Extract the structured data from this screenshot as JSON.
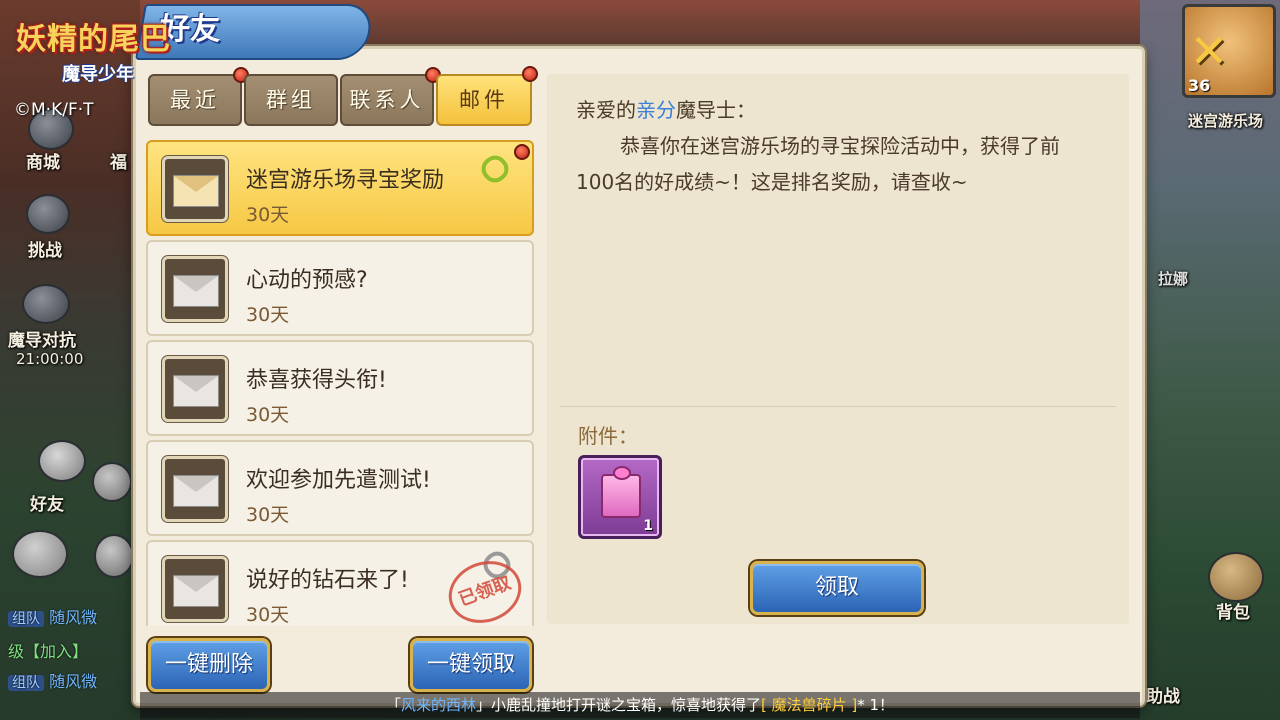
{
  "header": {
    "logo_main": "妖精的尾巴",
    "logo_sub": "魔导少年",
    "title": "好友",
    "copyright": "©M·K/F·T"
  },
  "left_side": {
    "shop": "商城",
    "welfare": "福",
    "challenge": "挑战",
    "arena": "魔导对抗",
    "arena_time": "21:00:00",
    "friends": "好友",
    "chat_lines": [
      {
        "tag": "组队",
        "text": "随风微"
      },
      {
        "tag": "",
        "text": "级【加入】"
      },
      {
        "tag": "组队",
        "text": "随风微"
      }
    ]
  },
  "right_side": {
    "level": "36",
    "event": "迷宫游乐场",
    "npc": "拉娜",
    "bag": "背包",
    "assist": "助战"
  },
  "tabs": [
    {
      "label": "最近",
      "active": false,
      "dot": true
    },
    {
      "label": "群组",
      "active": false,
      "dot": false
    },
    {
      "label": "联系人",
      "active": false,
      "dot": true
    },
    {
      "label": "邮件",
      "active": true,
      "dot": true
    }
  ],
  "mails": [
    {
      "title": "迷宫游乐场寻宝奖励",
      "days": "30天",
      "selected": true,
      "attachment": true,
      "claimed": false
    },
    {
      "title": "心动的预感?",
      "days": "30天",
      "selected": false,
      "attachment": false,
      "claimed": false
    },
    {
      "title": "恭喜获得头衔!",
      "days": "30天",
      "selected": false,
      "attachment": false,
      "claimed": false
    },
    {
      "title": "欢迎参加先遣测试!",
      "days": "30天",
      "selected": false,
      "attachment": false,
      "claimed": false
    },
    {
      "title": "说好的钻石来了!",
      "days": "30天",
      "selected": false,
      "attachment": true,
      "claimed": true
    }
  ],
  "claimed_stamp": "已领取",
  "buttons": {
    "delete_all": "一键删除",
    "claim_all": "一键领取",
    "claim": "领取"
  },
  "detail": {
    "greeting_prefix": "亲爱的",
    "greeting_name": "亲分",
    "greeting_suffix": "魔导士：",
    "body": "恭喜你在迷宫游乐场的寻宝探险活动中，获得了前100名的好成绩~！这是排名奖励，请查收~",
    "attachment_label": "附件：",
    "attachment_count": "1"
  },
  "marquee": {
    "open": "「",
    "name": "风来的西林",
    "close": "」",
    "text1": "小鹿乱撞地打开谜之宝箱，惊喜地获得了",
    "item": "[ 魔法兽碎片 ]",
    "text2": "* 1！"
  },
  "colors": {
    "tab_active": "#f3c13c",
    "tab_inactive": "#8b775c",
    "button_blue": "#2c64b5",
    "highlight_name": "#3a7fd8"
  }
}
